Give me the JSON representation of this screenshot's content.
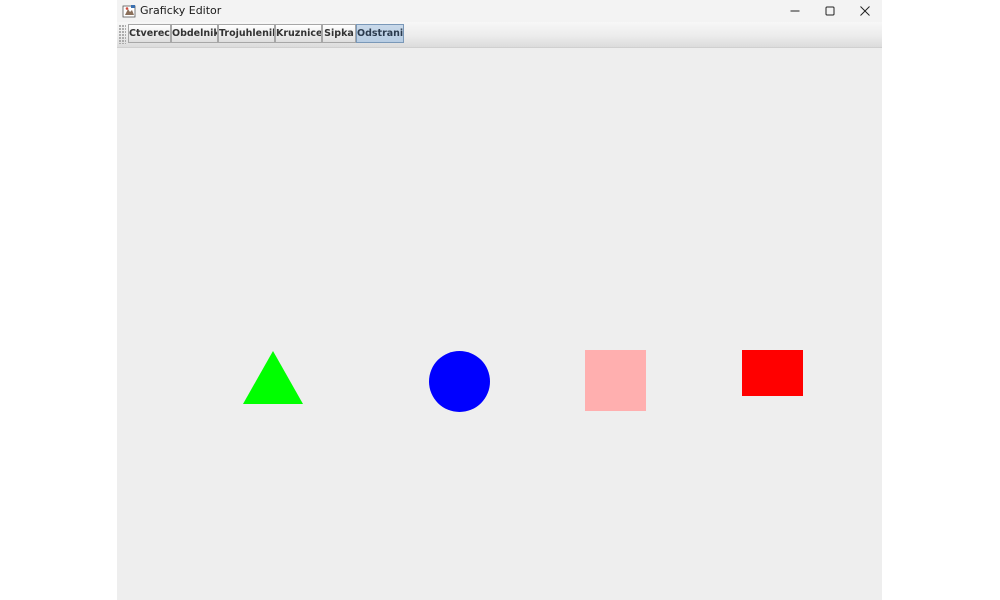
{
  "window": {
    "title": "Graficky Editor",
    "icon": "java-app-icon",
    "controls": {
      "minimize_icon": "minimize-icon",
      "maximize_icon": "maximize-icon",
      "close_icon": "close-icon"
    }
  },
  "toolbar": {
    "buttons": [
      {
        "label": "Ctverec",
        "selected": false
      },
      {
        "label": "Obdelnik",
        "selected": false
      },
      {
        "label": "Trojuhlenik",
        "selected": false
      },
      {
        "label": "Kruznice",
        "selected": false
      },
      {
        "label": "Sipka",
        "selected": false
      },
      {
        "label": "Odstranit",
        "selected": true
      }
    ]
  },
  "canvas": {
    "background": "#eeeeee",
    "shapes": [
      {
        "kind": "triangle",
        "color": "#00ff00"
      },
      {
        "kind": "circle",
        "color": "#0000ff"
      },
      {
        "kind": "square",
        "color": "#ffafaf"
      },
      {
        "kind": "rectangle",
        "color": "#ff0000"
      }
    ]
  }
}
